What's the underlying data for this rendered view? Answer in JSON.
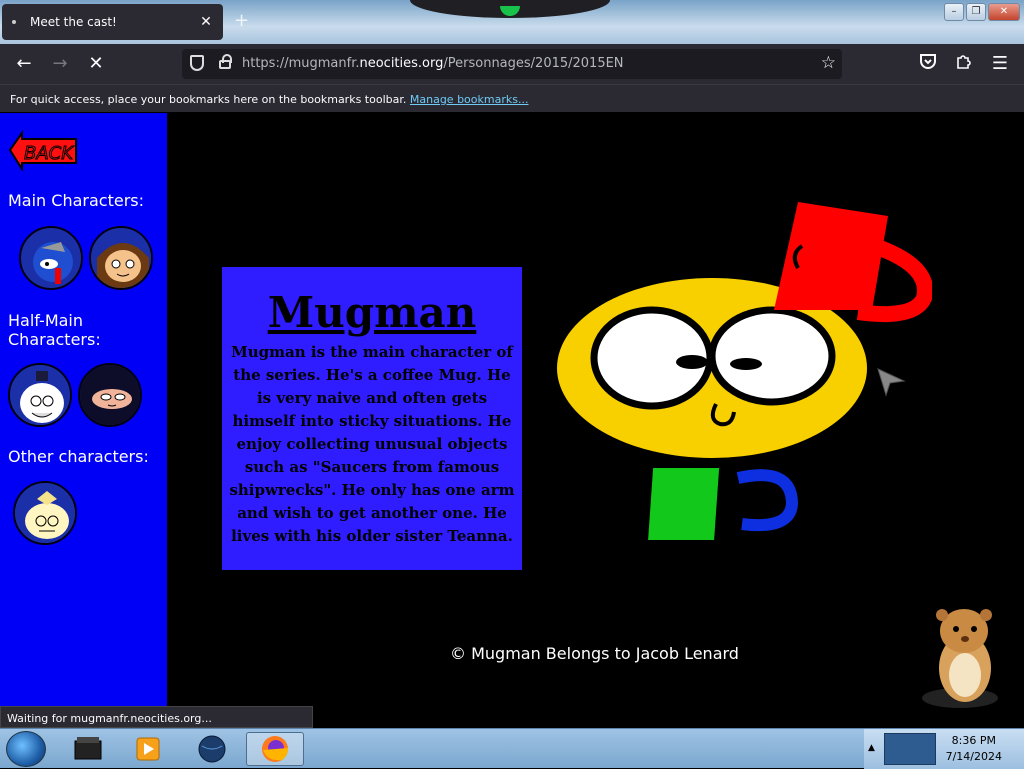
{
  "browser": {
    "tab_title": "Meet the cast!",
    "tab_close": "✕",
    "new_tab": "+",
    "url_prefix": "https://mugmanfr.",
    "url_host": "neocities.org",
    "url_path": "/Personnages/2015/2015EN",
    "bookmarks_text": "For quick access, place your bookmarks here on the bookmarks toolbar.",
    "bookmarks_link": "Manage bookmarks...",
    "status_text": "Waiting for mugmanfr.neocities.org..."
  },
  "sidebar": {
    "back_label": "BACK",
    "sections": [
      {
        "title": "Main Characters:"
      },
      {
        "title": "Half-Main Characters:"
      },
      {
        "title": "Other characters:"
      }
    ]
  },
  "main": {
    "name": "Mugman",
    "description": "Mugman is the main character of the series. He's a coffee Mug. He is very naive and often gets himself into sticky situations. He enjoy collecting unusual objects such as \"Saucers from famous shipwrecks\". He only has one arm and wish to get another one. He lives with his older sister Teanna.",
    "credit": "© Mugman Belongs to Jacob Lenard"
  },
  "taskbar": {
    "time": "8:36 PM",
    "date": "7/14/2024"
  },
  "colors": {
    "sidebar_bg": "#0000f6",
    "infobox_bg": "#2f1cff",
    "page_bg": "#000000"
  }
}
